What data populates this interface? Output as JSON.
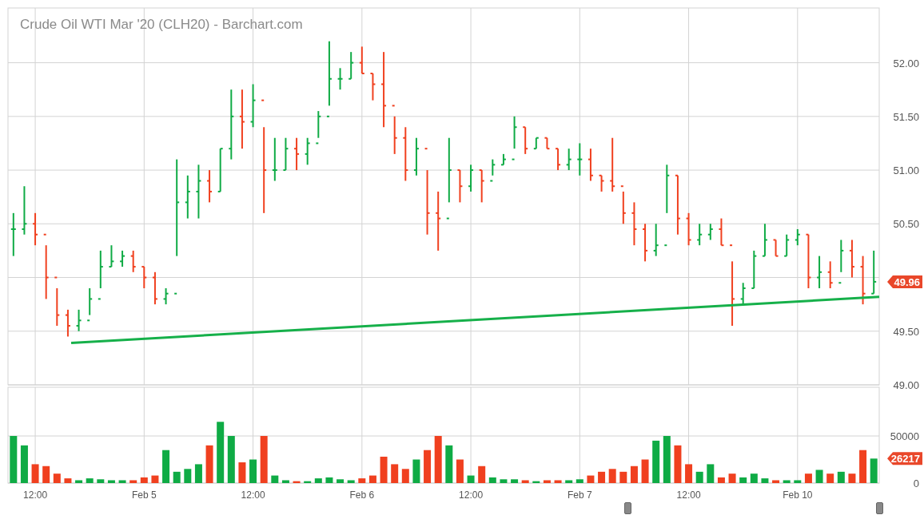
{
  "price_panel": {
    "title": "Crude Oil WTI Mar '20 (CLH20) - Barchart.com",
    "axis_labels_upper": [
      "52.00",
      "51.50",
      "51.00",
      "50.50"
    ],
    "axis_labels_lower": [
      "49.50",
      "49.00"
    ],
    "last_price_badge": "49.96"
  },
  "volume_panel": {
    "last_volume_badge": "26217",
    "chart_data": {
      "type": "bar",
      "grid": true,
      "ylim": [
        0,
        101700
      ],
      "categories": [
        null,
        null,
        "12:00",
        null,
        null,
        null,
        null,
        null,
        null,
        null,
        null,
        null,
        "Feb 5",
        null,
        null,
        null,
        null,
        null,
        null,
        null,
        null,
        null,
        "12:00",
        null,
        null,
        null,
        null,
        null,
        null,
        null,
        null,
        null,
        "Feb 6",
        null,
        null,
        null,
        null,
        null,
        null,
        null,
        null,
        null,
        "12:00",
        null,
        null,
        null,
        null,
        null,
        null,
        null,
        null,
        null,
        "Feb 7",
        null,
        null,
        null,
        null,
        null,
        null,
        null,
        null,
        null,
        "12:00",
        null,
        null,
        null,
        null,
        null,
        null,
        null,
        null,
        null,
        "Feb 10",
        null,
        null,
        null,
        null,
        null,
        null,
        null
      ],
      "yticks": [
        {
          "value": 0,
          "label": "0"
        },
        {
          "value": 50000,
          "label": "50000"
        }
      ],
      "values": [
        50000,
        40000,
        20000,
        18000,
        10000,
        5000,
        3000,
        5000,
        4000,
        3000,
        3000,
        3000,
        6000,
        8000,
        35000,
        12000,
        15000,
        20000,
        40000,
        65000,
        50000,
        22000,
        25000,
        50000,
        8000,
        3000,
        2000,
        2000,
        5000,
        6000,
        4000,
        3000,
        5000,
        8000,
        28000,
        20000,
        15000,
        25000,
        35000,
        50000,
        40000,
        25000,
        8000,
        18000,
        6000,
        4000,
        4000,
        3000,
        2000,
        3000,
        3000,
        3000,
        4000,
        8000,
        12000,
        15000,
        12000,
        18000,
        25000,
        45000,
        50000,
        40000,
        20000,
        12000,
        20000,
        6000,
        10000,
        6000,
        10000,
        5000,
        3000,
        3000,
        3000,
        10000,
        14000,
        10000,
        12000,
        10000,
        35000,
        26000
      ]
    }
  }
}
